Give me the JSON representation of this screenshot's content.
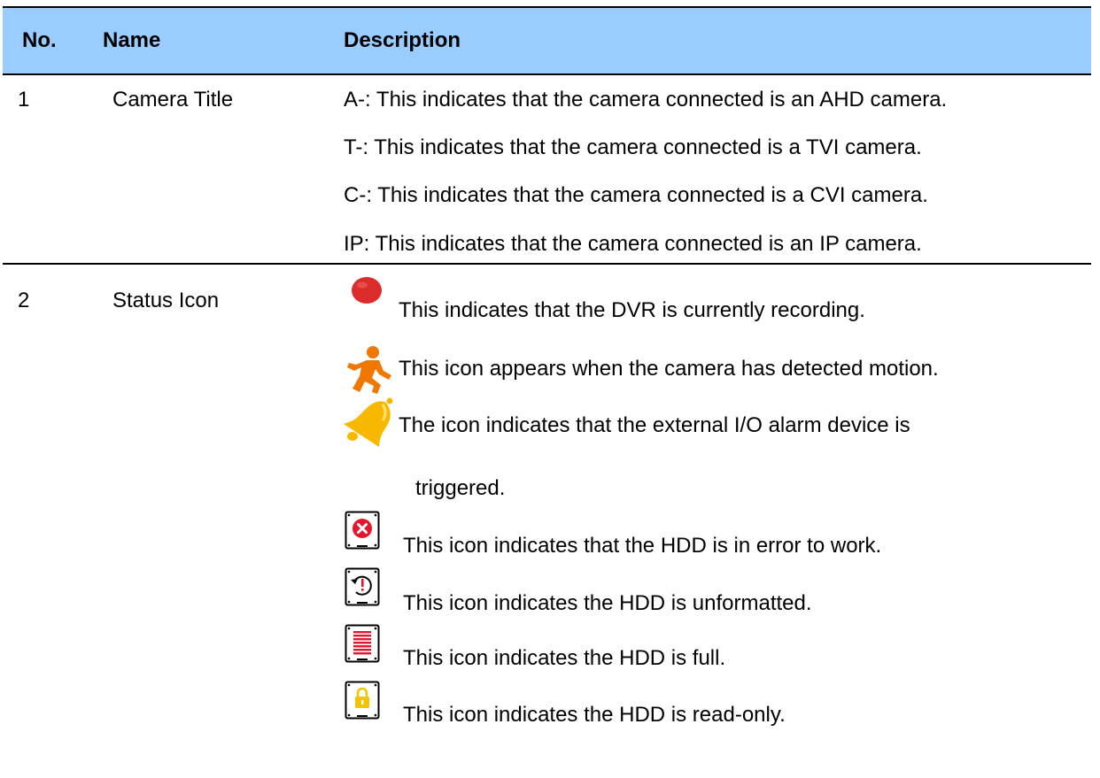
{
  "columns": {
    "no": "No.",
    "name": "Name",
    "description": "Description"
  },
  "rows": [
    {
      "no": "1",
      "name": "Camera Title",
      "lines": [
        "A-: This indicates that the camera connected is an AHD camera.",
        "T-: This indicates that the camera connected is a TVI camera.",
        "C-: This indicates that the camera connected is a CVI camera.",
        "IP: This indicates that the camera connected is an IP camera."
      ]
    },
    {
      "no": "2",
      "name": "Status Icon",
      "lines": [
        "This indicates that the DVR is currently recording.",
        "This icon appears when the camera has detected motion.",
        "The icon indicates that the external I/O alarm device is",
        "triggered.",
        "This icon indicates that the HDD is in error to work.",
        "This icon indicates the HDD is unformatted.",
        "This icon indicates the HDD is full.",
        "This icon indicates the HDD is read-only."
      ]
    }
  ],
  "icons": {
    "recording": "record-dot-icon",
    "motion": "running-person-icon",
    "alarm": "bell-icon",
    "hdd_error": "hdd-error-icon",
    "hdd_unformatted": "hdd-unformatted-icon",
    "hdd_full": "hdd-full-icon",
    "hdd_readonly": "hdd-lock-icon"
  },
  "colors": {
    "header_bg": "#99ccff",
    "record_red": "#dd2c2c",
    "motion_orange": "#f07800",
    "bell_yellow": "#f8b800",
    "lock_yellow": "#f5c400"
  }
}
